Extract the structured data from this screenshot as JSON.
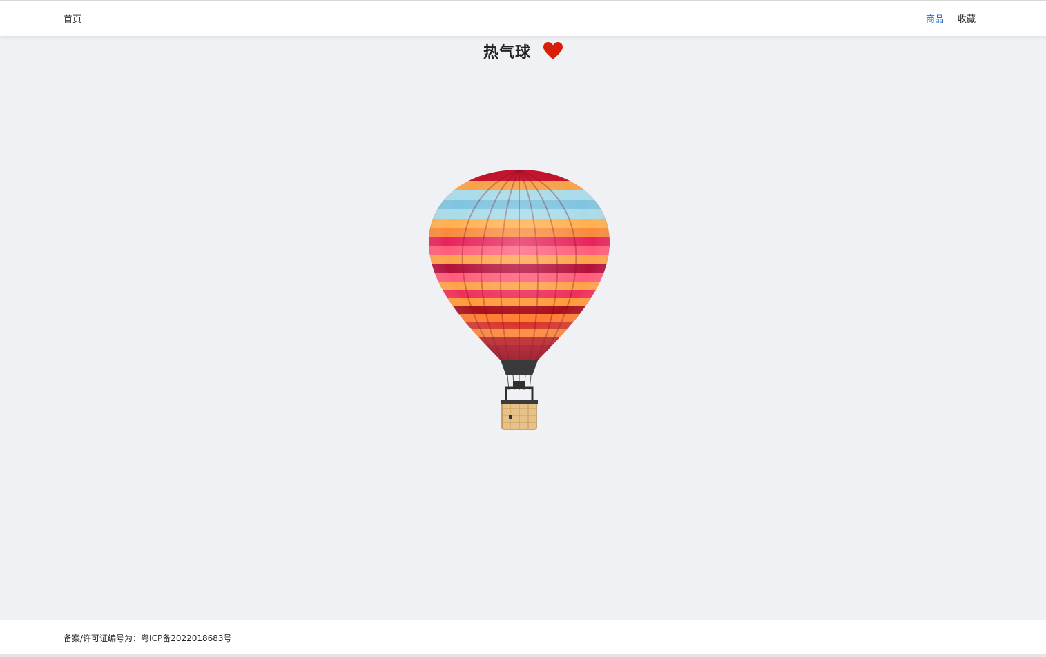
{
  "nav": {
    "home_label": "首页",
    "links": [
      {
        "label": "商品",
        "active": true
      },
      {
        "label": "收藏",
        "active": false
      }
    ],
    "active_color": "#2b6cc4"
  },
  "product": {
    "title": "热气球",
    "favorite_icon": "heart-icon",
    "favorite_color": "#d81e06",
    "image_subject": "hot-air-balloon"
  },
  "footer": {
    "icp_text": "备案/许可证编号为：粤ICP备2022018683号"
  }
}
